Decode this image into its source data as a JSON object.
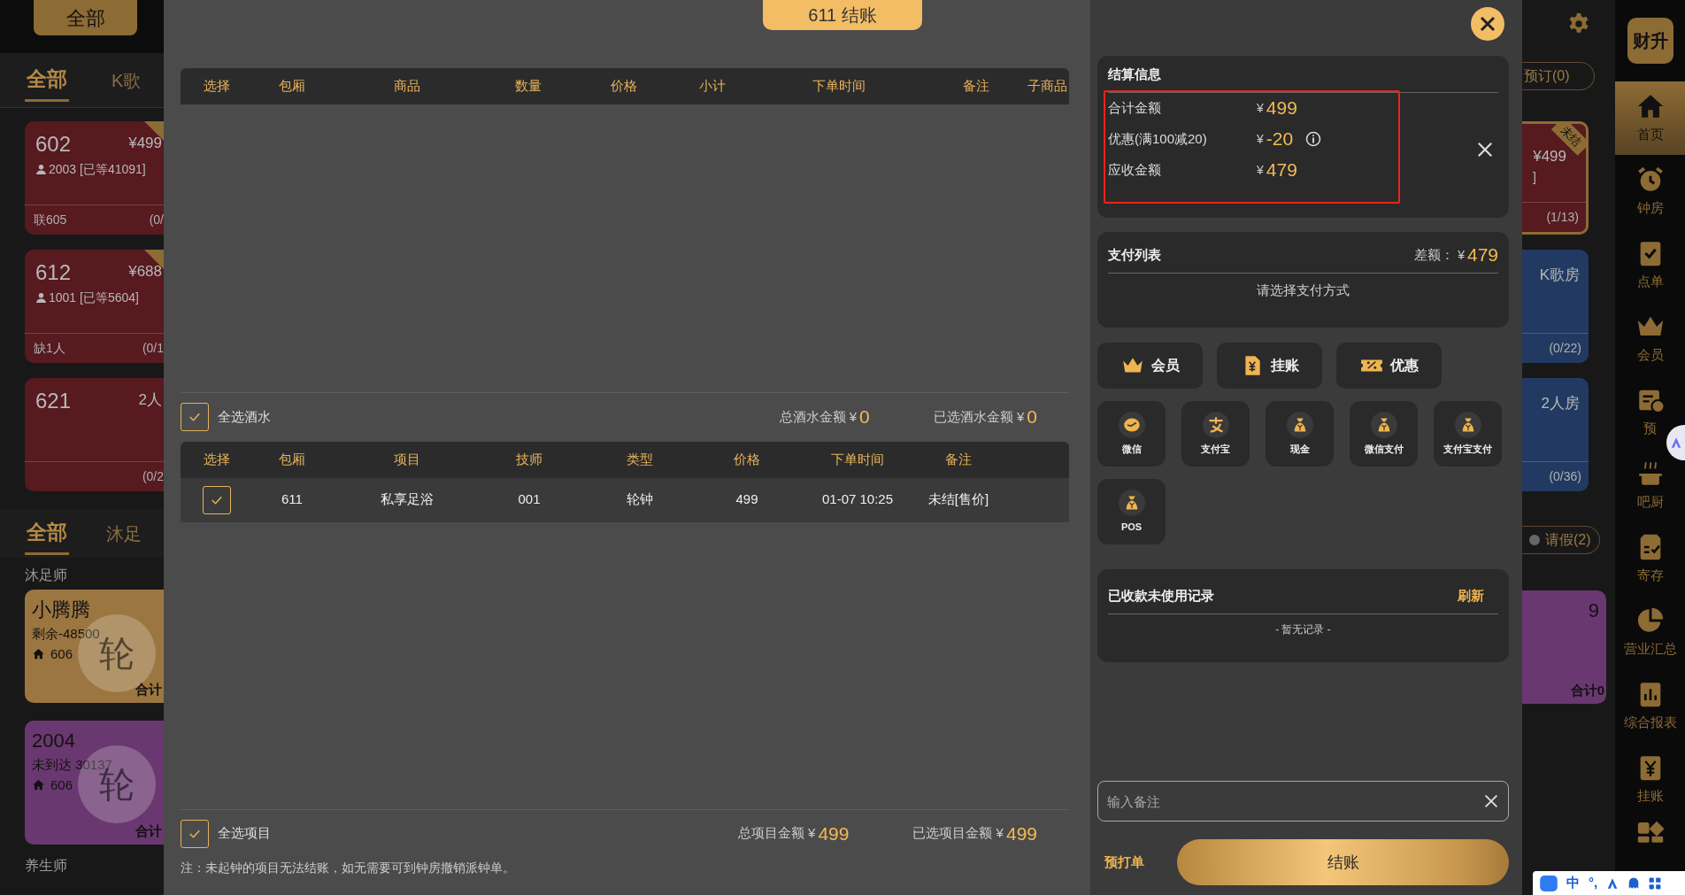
{
  "background": {
    "top_button": "全部",
    "room_tabs": [
      {
        "label": "全部",
        "selected": true
      },
      {
        "label": "K歌",
        "selected": false
      }
    ],
    "rooms_left": [
      {
        "name": "602",
        "price": "¥499",
        "guest": "2003 [已等41091]",
        "footer": "联605",
        "count": "(0/",
        "color": "#561a1f",
        "flagged": true
      },
      {
        "name": "612",
        "price": "¥688",
        "guest": "1001 [已等5604]",
        "footer": "缺1人",
        "count": "(0/1",
        "color": "#561a1f",
        "flagged": true
      },
      {
        "name": "621",
        "price": "2人",
        "count": "(0/2",
        "color": "#561a1f",
        "flagged": false
      }
    ],
    "staff_tabs": [
      {
        "label": "全部",
        "selected": true
      },
      {
        "label": "沐足",
        "selected": false
      }
    ],
    "staff_group": "沐足师",
    "staff_left": [
      {
        "name": "小腾腾",
        "balance": "剩余-48500",
        "room": "606",
        "badge": "轮",
        "total": "合计",
        "color": "#9c7640"
      },
      {
        "name": "2004",
        "balance": "未到达 30137",
        "room": "606",
        "badge": "轮",
        "total": "合计",
        "color": "#6a3870"
      }
    ],
    "next_group": "养生师",
    "reservations": "预订(0)",
    "rooms_right": [
      {
        "tag": "未结",
        "price": "¥499",
        "guest": "]",
        "count": "(1/13)",
        "color": "#561a1f"
      },
      {
        "type": "K歌房",
        "count": "(0/22)",
        "color": "#223a62"
      },
      {
        "type": "2人房",
        "count": "(0/36)",
        "color": "#223a62"
      }
    ],
    "leave": "请假(2)",
    "staff_right": [
      {
        "count": "9",
        "total": "合计0",
        "color": "#6a3870"
      }
    ]
  },
  "sidebar": {
    "logo": "财升",
    "items": [
      {
        "label": "首页",
        "selected": true
      },
      {
        "label": "钟房",
        "selected": false
      },
      {
        "label": "点单",
        "selected": false
      },
      {
        "label": "会员",
        "selected": false
      },
      {
        "label": "预",
        "selected": false
      },
      {
        "label": "吧厨",
        "selected": false
      },
      {
        "label": "寄存",
        "selected": false
      },
      {
        "label": "营业汇总",
        "selected": false
      },
      {
        "label": "综合报表",
        "selected": false
      },
      {
        "label": "挂账",
        "selected": false
      }
    ]
  },
  "modal": {
    "title": "611 结账",
    "drinks": {
      "columns": [
        "选择",
        "包厢",
        "商品",
        "数量",
        "价格",
        "小计",
        "下单时间",
        "备注",
        "子商品"
      ],
      "select_all": {
        "label": "全选酒水",
        "checked": true
      },
      "total_label": "总酒水金额 ¥",
      "total": "0",
      "selected_label": "已选酒水金额 ¥",
      "selected_total": "0"
    },
    "items": {
      "columns": [
        "选择",
        "包厢",
        "项目",
        "技师",
        "类型",
        "价格",
        "下单时间",
        "备注"
      ],
      "rows": [
        {
          "checked": true,
          "cells": [
            "",
            "611",
            "私享足浴",
            "001",
            "轮钟",
            "499",
            "01-07 10:25",
            "未结[售价]"
          ]
        }
      ],
      "select_all": {
        "label": "全选项目",
        "checked": true
      },
      "total_label": "总项目金额 ¥",
      "total": "499",
      "selected_label": "已选项目金额 ¥",
      "selected_total": "499"
    },
    "note": "注：未起钟的项目无法结账，如无需要可到钟房撤销派钟单。",
    "settlement": {
      "title": "结算信息",
      "highlighted": true,
      "rows": [
        {
          "label": "合计金额",
          "currency": "¥",
          "amount": "499",
          "info": false,
          "removable": false
        },
        {
          "label": "优惠(满100减20)",
          "currency": "¥",
          "amount": "-20",
          "info": true,
          "removable": true
        },
        {
          "label": "应收金额",
          "currency": "¥",
          "amount": "479",
          "info": false,
          "removable": false
        }
      ]
    },
    "payments": {
      "title": "支付列表",
      "balance_label": "差额：",
      "currency": "¥",
      "balance": "479",
      "empty": "请选择支付方式"
    },
    "actions": [
      {
        "label": "会员",
        "kind": "crown"
      },
      {
        "label": "挂账",
        "kind": "credit"
      },
      {
        "label": "优惠",
        "kind": "coupon"
      }
    ],
    "methods": [
      {
        "label": "微信",
        "kind": "wechat"
      },
      {
        "label": "支付宝",
        "kind": "alipay"
      },
      {
        "label": "现金",
        "kind": "bag"
      },
      {
        "label": "微信支付",
        "kind": "bag"
      },
      {
        "label": "支付宝支付",
        "kind": "bag"
      },
      {
        "label": "POS",
        "kind": "bag"
      }
    ],
    "records": {
      "title": "已收款未使用记录",
      "action": "刷新",
      "empty": "- 暂无记录 -"
    },
    "remark": {
      "placeholder": "输入备注"
    },
    "preprint": "预打单",
    "checkout": "结账"
  },
  "ime_bar": [
    "中",
    "°,"
  ]
}
